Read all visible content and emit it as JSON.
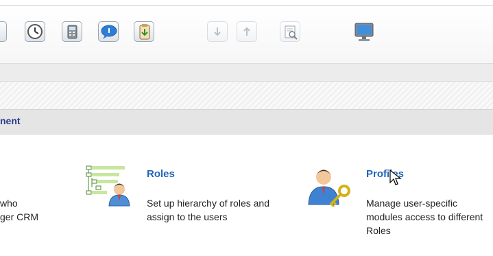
{
  "toolbar": {
    "buttons": [
      {
        "name": "partial-toolbar-button"
      },
      {
        "name": "clock-icon"
      },
      {
        "name": "calculator-icon"
      },
      {
        "name": "chat-icon"
      },
      {
        "name": "clipboard-import-icon"
      },
      {
        "name": "import-arrow-icon"
      },
      {
        "name": "export-arrow-icon"
      },
      {
        "name": "find-duplicates-icon"
      },
      {
        "name": "monitor-icon"
      }
    ]
  },
  "section": {
    "title": "nent"
  },
  "partial_item": {
    "line1": "who",
    "line2": "ger CRM"
  },
  "roles": {
    "title": "Roles",
    "description": "Set up hierarchy of roles and assign to the users"
  },
  "profiles": {
    "title": "Profiles",
    "description": "Manage user-specific modules access to different Roles"
  },
  "colors": {
    "link": "#1f65b8",
    "section_title": "#2b3a8c"
  }
}
